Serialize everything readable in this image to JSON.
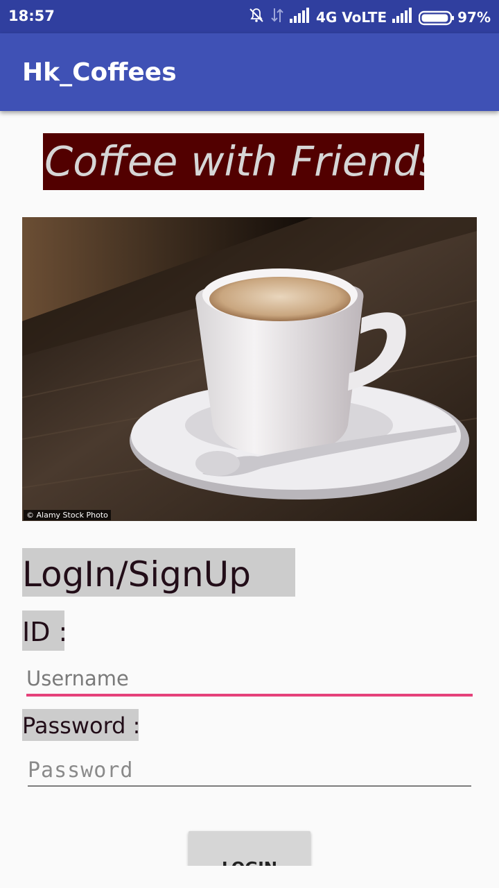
{
  "status_bar": {
    "time": "18:57",
    "network": "4G VoLTE",
    "battery": "97%",
    "battery_level": 0.97,
    "icons": [
      "mute-icon",
      "data-arrows-icon",
      "signal-icon",
      "signal-icon",
      "battery-icon"
    ]
  },
  "app_bar": {
    "title": "Hk_Coffees",
    "color": "#3f51b5"
  },
  "banner": {
    "text": "Coffee with Friends",
    "background": "#520000"
  },
  "hero_image": {
    "credit": "© Alamy Stock Photo"
  },
  "form": {
    "heading": "LogIn/SignUp",
    "id_label": "ID :",
    "username_placeholder": "Username",
    "password_label": "Password :",
    "password_placeholder": "Password",
    "login_label": "LOGIN"
  },
  "colors": {
    "accent": "#e5417a",
    "status_bar": "#303f9f",
    "label_bg": "#cccccc"
  }
}
